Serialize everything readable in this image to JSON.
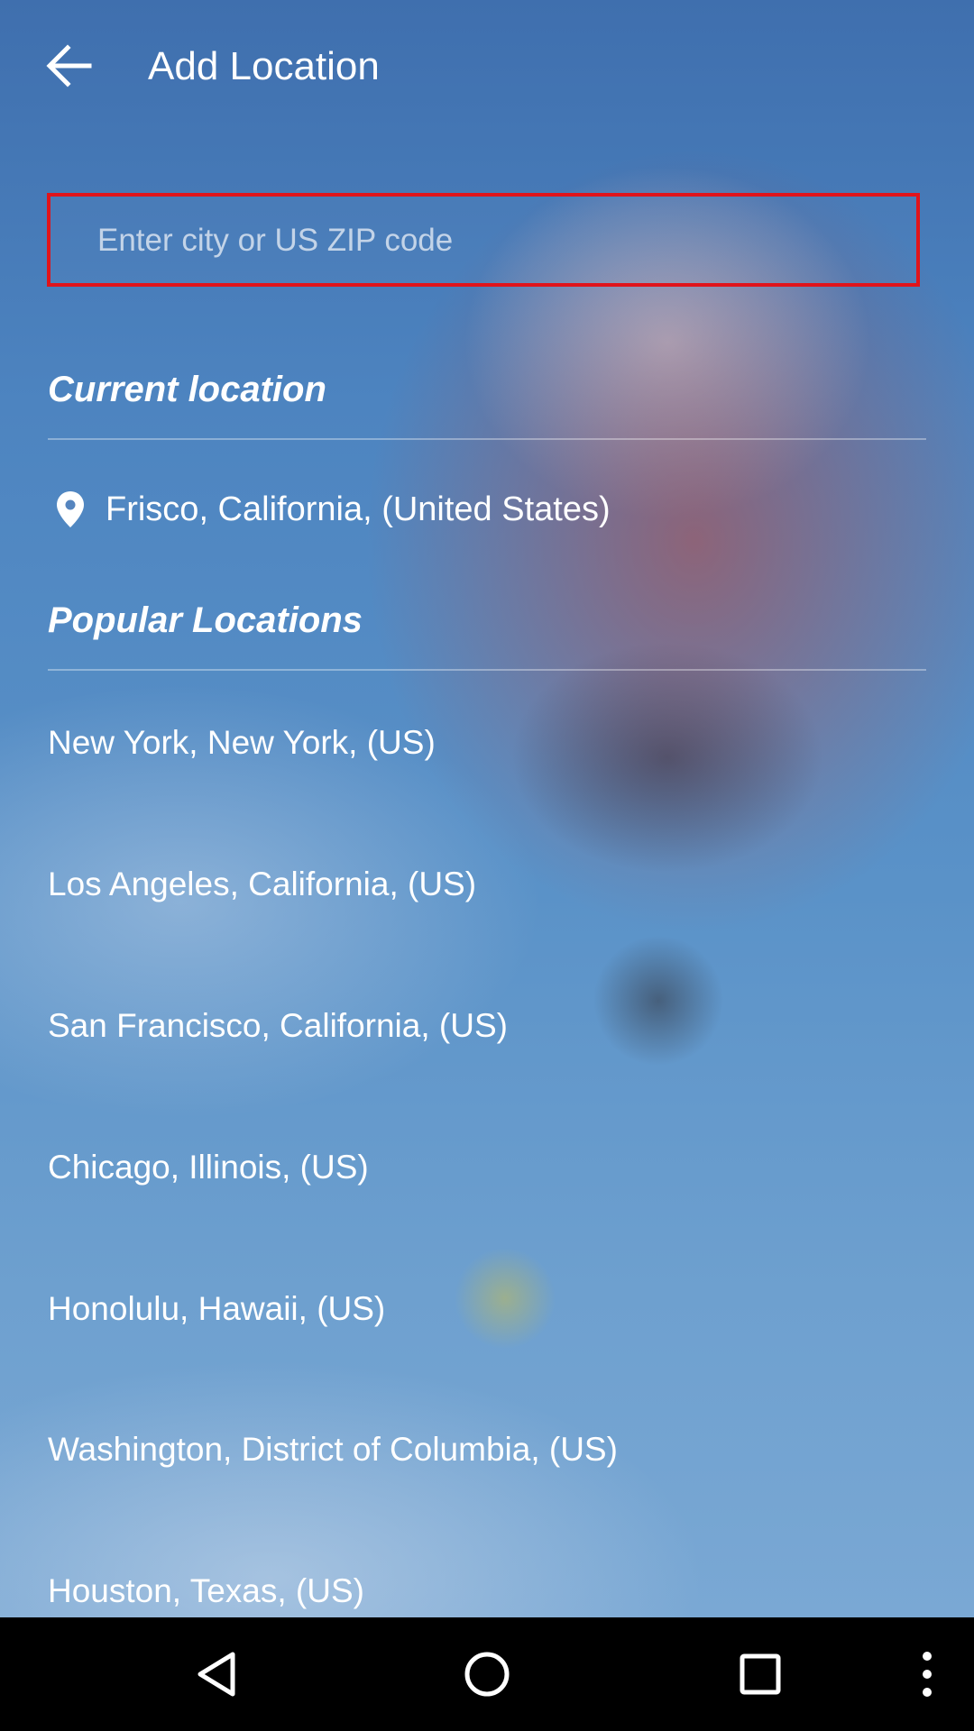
{
  "header": {
    "title": "Add Location",
    "back_icon": "arrow-back-icon"
  },
  "search": {
    "placeholder": "Enter city or US ZIP code",
    "value": ""
  },
  "current_location": {
    "heading": "Current location",
    "icon": "location-pin-icon",
    "label": "Frisco, California, (United States)"
  },
  "popular": {
    "heading": "Popular Locations",
    "items": [
      "New York, New York, (US)",
      "Los Angeles, California, (US)",
      "San Francisco, California, (US)",
      "Chicago, Illinois, (US)",
      "Honolulu, Hawaii, (US)",
      "Washington, District of Columbia, (US)",
      "Houston, Texas, (US)"
    ]
  },
  "navbar": {
    "icons": [
      "nav-back-icon",
      "nav-home-icon",
      "nav-recents-icon",
      "overflow-menu-icon"
    ]
  },
  "colors": {
    "search_border": "#e0141b",
    "text": "#ffffff",
    "navbar": "#000000"
  }
}
